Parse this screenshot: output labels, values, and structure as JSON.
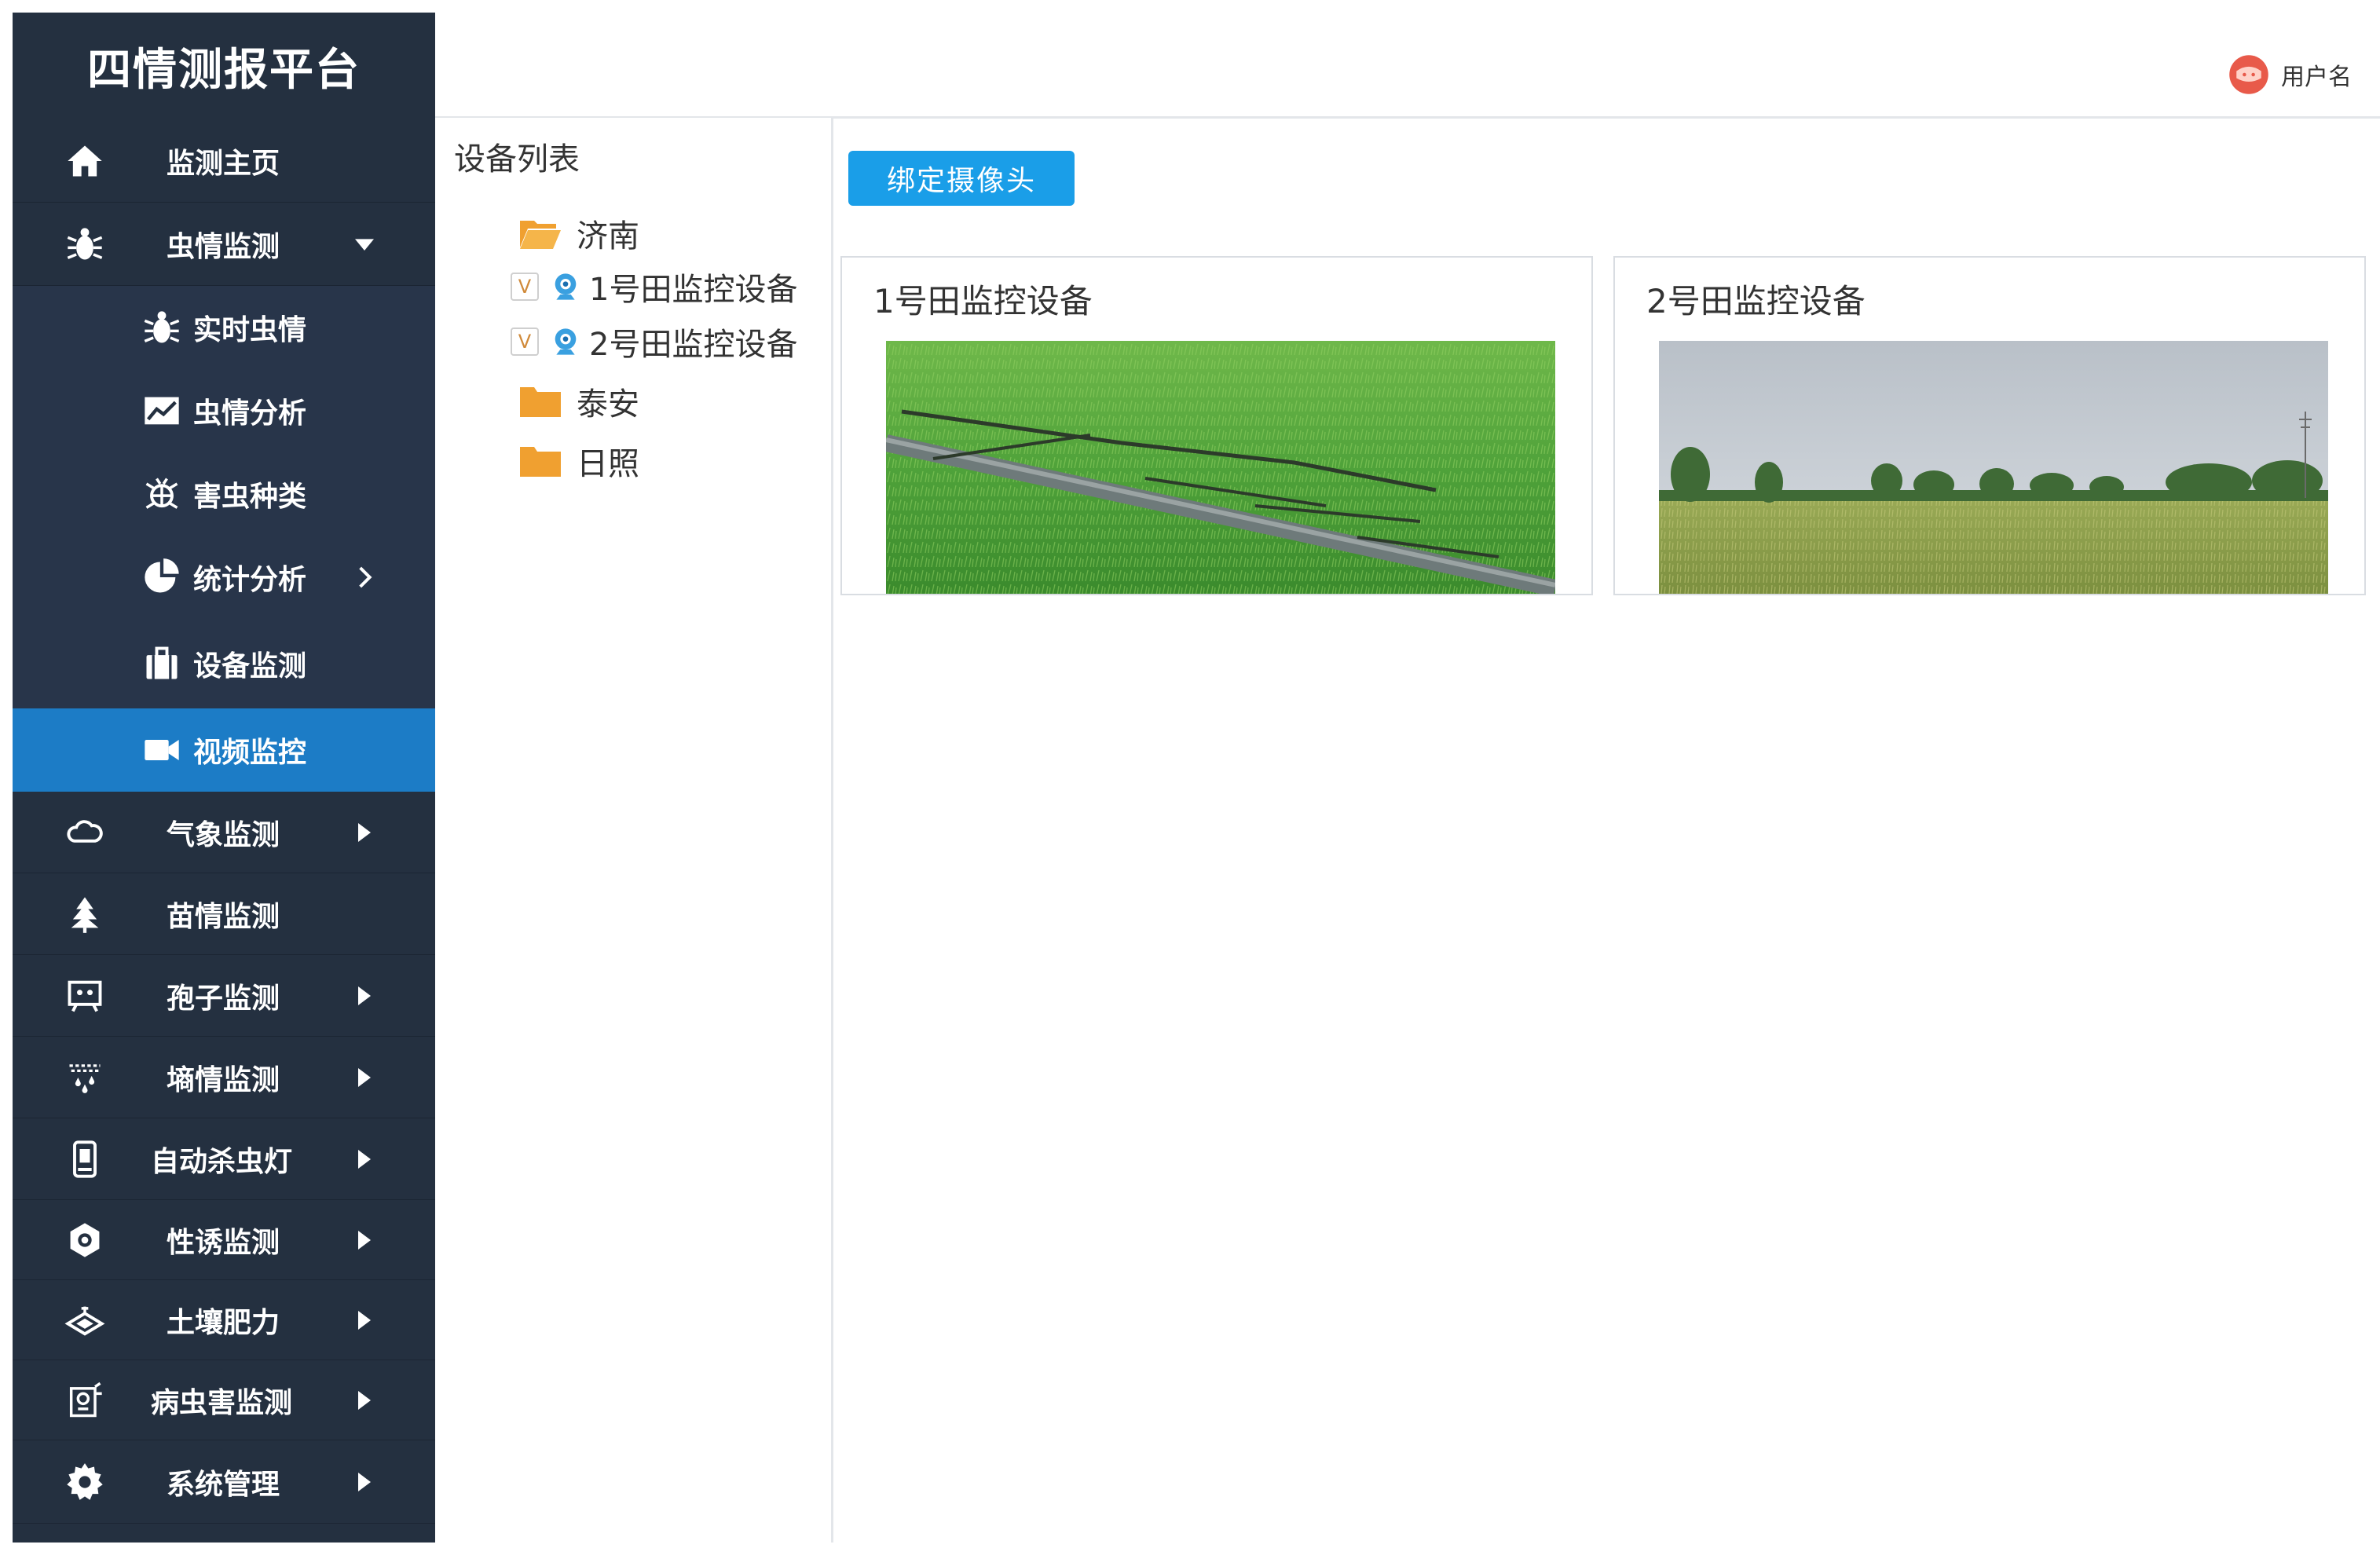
{
  "app": {
    "title": "四情测报平台"
  },
  "header": {
    "user_name": "用户名"
  },
  "sidebar": {
    "items": [
      {
        "label": "监测主页",
        "icon": "home-icon"
      },
      {
        "label": "虫情监测",
        "icon": "bug-icon",
        "expanded": true
      },
      {
        "label": "实时虫情",
        "icon": "bug-icon"
      },
      {
        "label": "虫情分析",
        "icon": "chart-icon"
      },
      {
        "label": "害虫种类",
        "icon": "pest-icon"
      },
      {
        "label": "统计分析",
        "icon": "pie-icon"
      },
      {
        "label": "设备监测",
        "icon": "device-icon"
      },
      {
        "label": "视频监控",
        "icon": "video-icon",
        "active": true
      },
      {
        "label": "气象监测",
        "icon": "cloud-icon"
      },
      {
        "label": "苗情监测",
        "icon": "tree-icon"
      },
      {
        "label": "孢子监测",
        "icon": "spore-icon"
      },
      {
        "label": "墒情监测",
        "icon": "moisture-icon"
      },
      {
        "label": "自动杀虫灯",
        "icon": "lamp-icon"
      },
      {
        "label": "性诱监测",
        "icon": "lure-icon"
      },
      {
        "label": "土壤肥力",
        "icon": "soil-icon"
      },
      {
        "label": "病虫害监测",
        "icon": "disease-icon"
      },
      {
        "label": "系统管理",
        "icon": "gear-icon"
      }
    ]
  },
  "tree": {
    "title": "设备列表",
    "nodes": [
      {
        "label": "济南",
        "type": "folder-open"
      },
      {
        "label": "1号田监控设备",
        "type": "camera",
        "checked": true
      },
      {
        "label": "2号田监控设备",
        "type": "camera",
        "checked": true
      },
      {
        "label": "泰安",
        "type": "folder"
      },
      {
        "label": "日照",
        "type": "folder"
      }
    ],
    "check_mark": "V"
  },
  "main": {
    "bind_button": "绑定摄像头",
    "cards": [
      {
        "title": "1号田监控设备"
      },
      {
        "title": "2号田监控设备"
      }
    ]
  },
  "colors": {
    "sidebar_bg": "#243040",
    "active_bg": "#1c7cc6",
    "button_bg": "#1a9ee8",
    "folder": "#f0a030",
    "camera": "#3aa0e0"
  }
}
